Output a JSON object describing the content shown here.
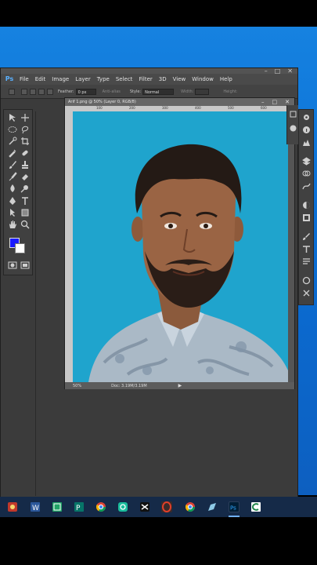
{
  "app": {
    "logo": "Ps",
    "menu": [
      "File",
      "Edit",
      "Image",
      "Layer",
      "Type",
      "Select",
      "Filter",
      "3D",
      "View",
      "Window",
      "Help"
    ],
    "window_controls": [
      "–",
      "□",
      "✕"
    ]
  },
  "options_bar": {
    "feather_label": "Feather:",
    "feather_value": "0 px",
    "antialias_label": "Anti-alias",
    "style_label": "Style:",
    "style_value": "Normal",
    "width_label": "Width:",
    "height_label": "Height:"
  },
  "document": {
    "title": "Arif 1.png @ 50% (Layer 0, RGB/8)",
    "controls": [
      "–",
      "□",
      "✕"
    ],
    "ruler_marks": [
      "100",
      "200",
      "300",
      "400",
      "500",
      "600"
    ],
    "zoom": "50%",
    "doc_size": "Doc: 3.19M/3.19M",
    "status_arrow": "▶"
  },
  "colors": {
    "foreground": "#1a1aff",
    "background": "#ffffff",
    "canvas_bg": "#1fa4cd"
  },
  "tools": [
    "move-tool",
    "marquee-tool",
    "lasso-tool",
    "quick-select-tool",
    "crop-tool",
    "eyedropper-tool",
    "healing-tool",
    "brush-tool",
    "clone-stamp-tool",
    "history-brush-tool",
    "eraser-tool",
    "gradient-tool",
    "blur-tool",
    "dodge-tool",
    "pen-tool",
    "type-tool",
    "path-select-tool",
    "shape-tool",
    "hand-tool",
    "zoom-tool"
  ],
  "taskbar": {
    "apps": [
      "photo-app",
      "word",
      "excel-green",
      "publisher",
      "chrome",
      "share-app",
      "capcut",
      "opera",
      "chrome-2",
      "notepad",
      "photoshop",
      "camtasia"
    ]
  }
}
